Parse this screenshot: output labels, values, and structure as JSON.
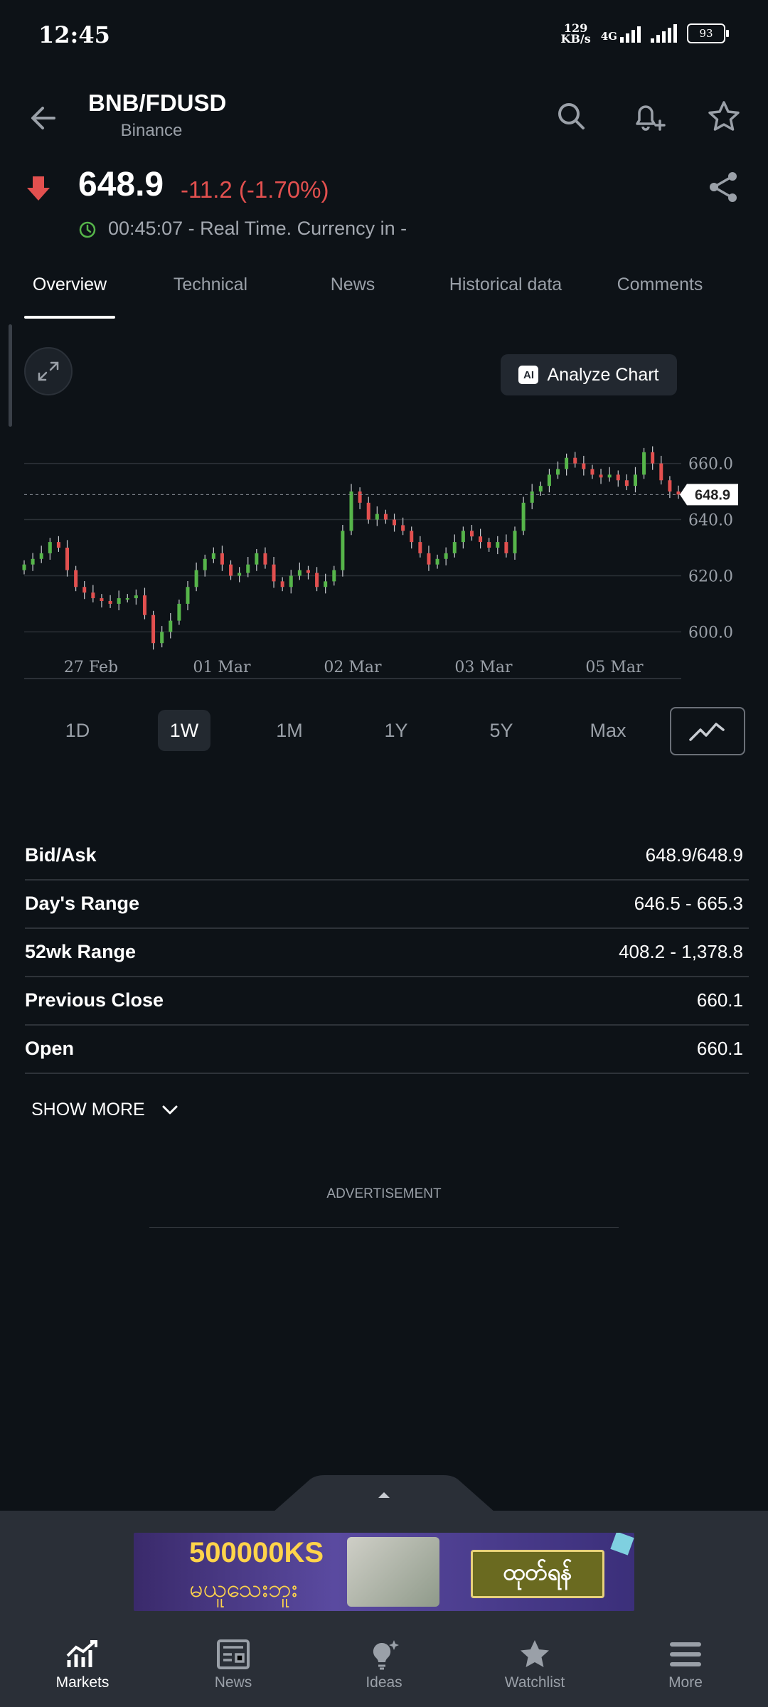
{
  "status": {
    "time": "12:45",
    "net_speed_value": "129",
    "net_speed_unit": "KB/s",
    "network": "4G",
    "battery": "93"
  },
  "header": {
    "symbol": "BNB/FDUSD",
    "exchange": "Binance"
  },
  "quote": {
    "price": "648.9",
    "change": "-11.2 (-1.70%)",
    "time_note": "00:45:07 - Real Time. Currency in -",
    "direction": "down",
    "down_color": "#e2504f",
    "up_color": "#56b54a"
  },
  "tabs": [
    "Overview",
    "Technical",
    "News",
    "Historical data",
    "Comments"
  ],
  "analyze_label": "Analyze Chart",
  "ai_badge": "AI",
  "chart_data": {
    "type": "candlestick",
    "y_ticks": [
      "660.0",
      "640.0",
      "620.0",
      "600.0"
    ],
    "ylim": [
      592,
      668
    ],
    "x_labels": [
      "27 Feb",
      "01 Mar",
      "02 Mar",
      "03 Mar",
      "05 Mar"
    ],
    "current_price_label": "648.9",
    "close_series": [
      624,
      626,
      628,
      632,
      630,
      622,
      616,
      614,
      612,
      611,
      610,
      612,
      612,
      613,
      606,
      596,
      600,
      604,
      610,
      616,
      622,
      626,
      628,
      624,
      620,
      621,
      624,
      628,
      624,
      618,
      616,
      620,
      622,
      621,
      616,
      618,
      622,
      636,
      650,
      646,
      640,
      642,
      640,
      638,
      636,
      632,
      628,
      624,
      626,
      628,
      632,
      636,
      634,
      632,
      630,
      632,
      628,
      636,
      646,
      650,
      652,
      656,
      658,
      662,
      660,
      658,
      656,
      655,
      656,
      654,
      652,
      656,
      664,
      660,
      654,
      650,
      648.9
    ]
  },
  "periods": [
    "1D",
    "1W",
    "1M",
    "1Y",
    "5Y",
    "Max"
  ],
  "active_period": "1W",
  "stats": [
    {
      "label": "Bid/Ask",
      "value": "648.9/648.9"
    },
    {
      "label": "Day's Range",
      "value": "646.5 - 665.3"
    },
    {
      "label": "52wk Range",
      "value": "408.2 - 1,378.8"
    },
    {
      "label": "Previous Close",
      "value": "660.1"
    },
    {
      "label": "Open",
      "value": "660.1"
    }
  ],
  "show_more": "SHOW MORE",
  "advertisement_label": "ADVERTISEMENT",
  "ad_banner": {
    "amount": "500000KS",
    "sub": "မယူသေးဘူး",
    "cta": "ထုတ်ရန်"
  },
  "nav": [
    "Markets",
    "News",
    "Ideas",
    "Watchlist",
    "More"
  ]
}
